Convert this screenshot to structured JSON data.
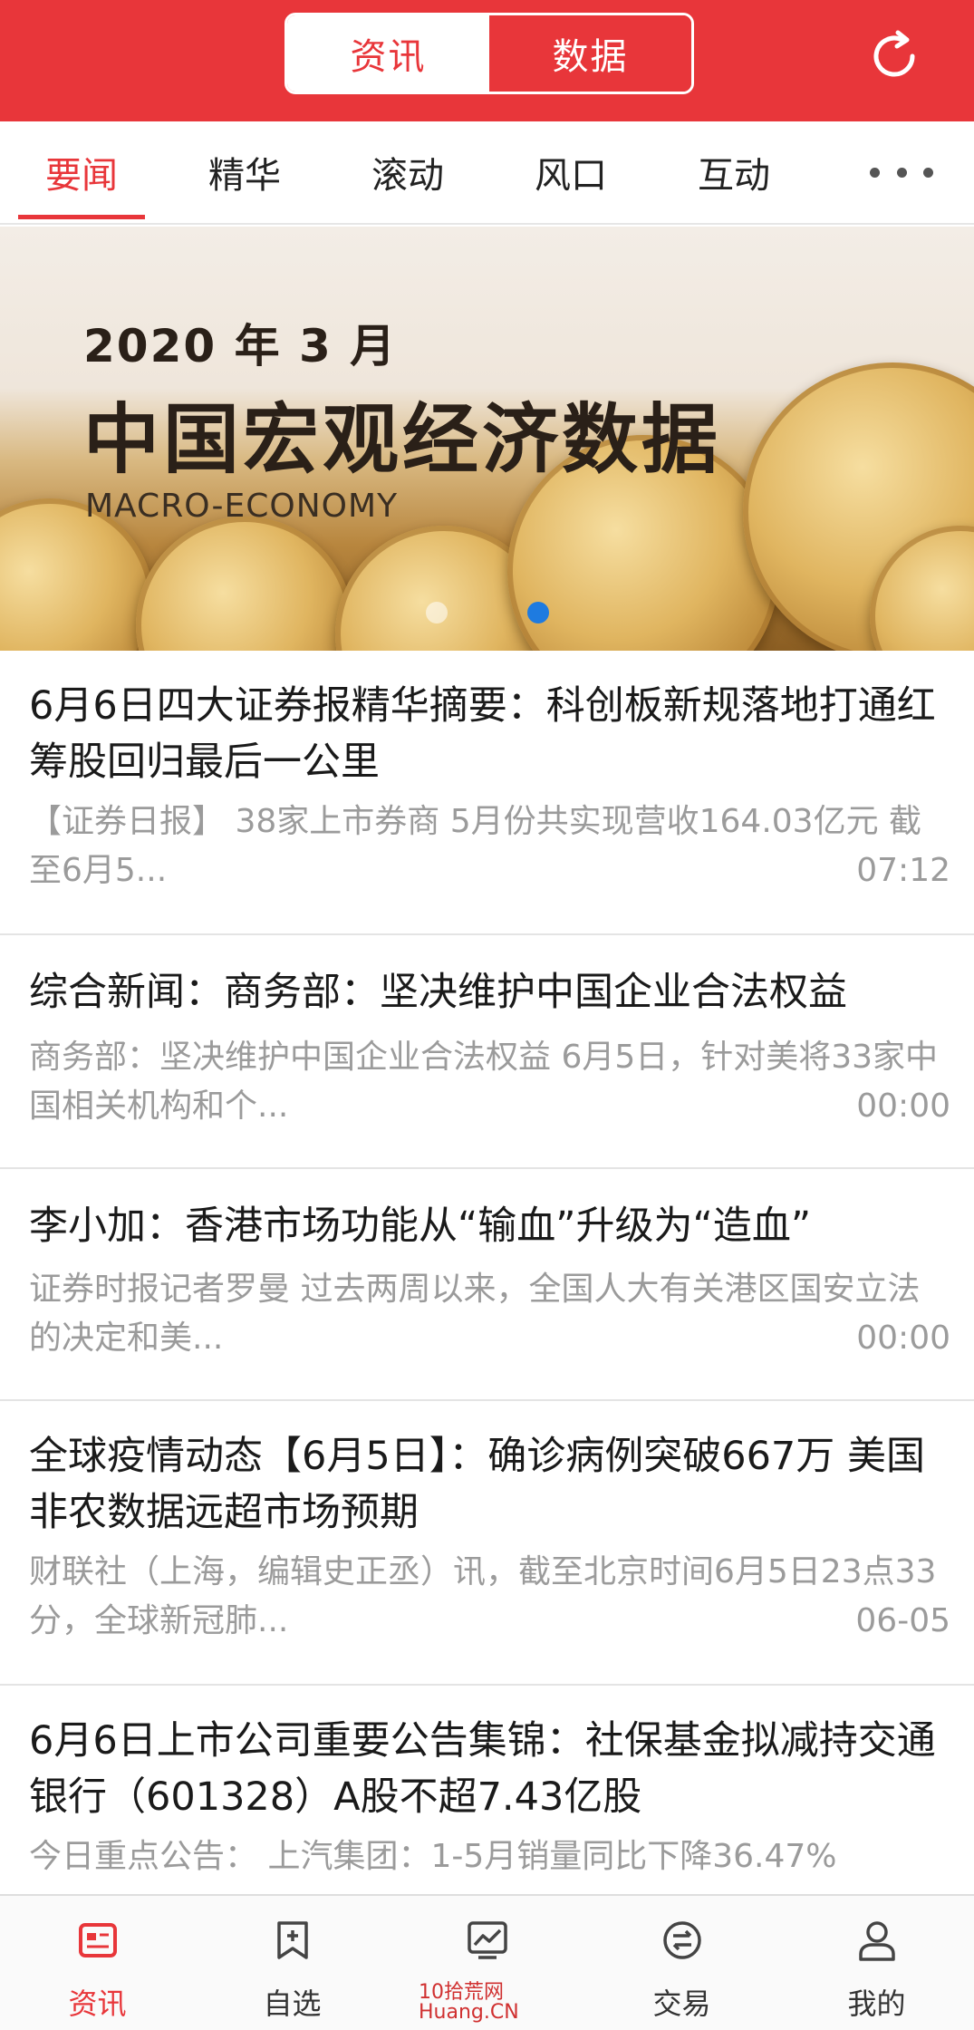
{
  "header": {
    "segment": [
      "资讯",
      "数据"
    ],
    "active_segment": "资讯",
    "refresh_icon": "refresh-icon",
    "accent_color": "#e8363a"
  },
  "tabs": {
    "items": [
      "要闻",
      "精华",
      "滚动",
      "风口",
      "互动"
    ],
    "active": "要闻",
    "more_icon": "more-dots-icon"
  },
  "banner": {
    "year": "2020 年 3 月",
    "title": "中国宏观经济数据",
    "subtitle": "MACRO-ECONOMY",
    "slide_count": 2,
    "active_slide": 2
  },
  "news": [
    {
      "title": "6月6日四大证券报精华摘要：科创板新规落地打通红筹股回归最后一公里",
      "summary": "【证券日报】 38家上市券商 5月份共实现营收164.03亿元 截至6月5...",
      "time": "07:12"
    },
    {
      "title": "综合新闻：商务部：坚决维护中国企业合法权益",
      "summary": "商务部：坚决维护中国企业合法权益 6月5日，针对美将33家中国相关机构和个...",
      "time": "00:00"
    },
    {
      "title": "李小加：香港市场功能从“输血”升级为“造血”",
      "summary": "证券时报记者罗曼 过去两周以来，全国人大有关港区国安立法的决定和美...",
      "time": "00:00"
    },
    {
      "title": "全球疫情动态【6月5日】：确诊病例突破667万 美国非农数据远超市场预期",
      "summary": "财联社（上海，编辑史正丞）讯，截至北京时间6月5日23点33分，全球新冠肺...",
      "time": "06-05"
    },
    {
      "title": "6月6日上市公司重要公告集锦：社保基金拟减持交通银行（601328）A股不超7.43亿股",
      "summary": "今日重点公告： 上汽集团：1-5月销量同比下降36.47%",
      "time": ""
    }
  ],
  "bottom_nav": [
    {
      "label": "资讯",
      "icon": "news-icon",
      "active": true
    },
    {
      "label": "自选",
      "icon": "bookmark-add-icon",
      "active": false
    },
    {
      "label": "",
      "icon": "chart-icon",
      "active": false
    },
    {
      "label": "交易",
      "icon": "trade-icon",
      "active": false
    },
    {
      "label": "我的",
      "icon": "profile-icon",
      "active": false
    }
  ],
  "watermark": {
    "line1": "10拾荒网",
    "line2": "Huang.CN"
  }
}
